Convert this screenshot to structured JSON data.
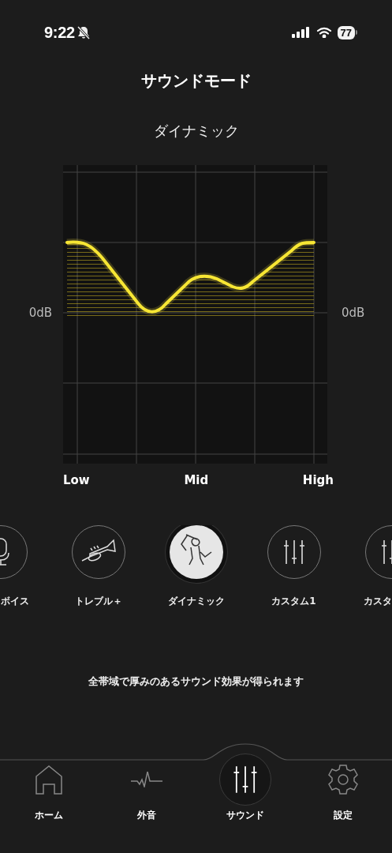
{
  "status_bar": {
    "time": "9:22",
    "battery": "77"
  },
  "header": {
    "title": "サウンドモード",
    "mode_name": "ダイナミック"
  },
  "eq_chart": {
    "left_label": "0dB",
    "right_label": "0dB",
    "x_labels": [
      "Low",
      "Mid",
      "High"
    ]
  },
  "modes": [
    {
      "label": "ボイス",
      "kind": "mic",
      "selected": false
    },
    {
      "label": "トレブル＋",
      "kind": "trumpet",
      "selected": false
    },
    {
      "label": "ダイナミック",
      "kind": "dancer",
      "selected": true
    },
    {
      "label": "カスタム1",
      "kind": "sliders",
      "selected": false
    },
    {
      "label": "カスタ",
      "kind": "sliders",
      "selected": false
    }
  ],
  "description": "全帯域で厚みのあるサウンド効果が得られます",
  "tab_bar": [
    {
      "label": "ホーム",
      "kind": "home",
      "selected": false
    },
    {
      "label": "外音",
      "kind": "wave",
      "selected": false
    },
    {
      "label": "サウンド",
      "kind": "sliders",
      "selected": true
    },
    {
      "label": "設定",
      "kind": "gear",
      "selected": false
    }
  ]
}
